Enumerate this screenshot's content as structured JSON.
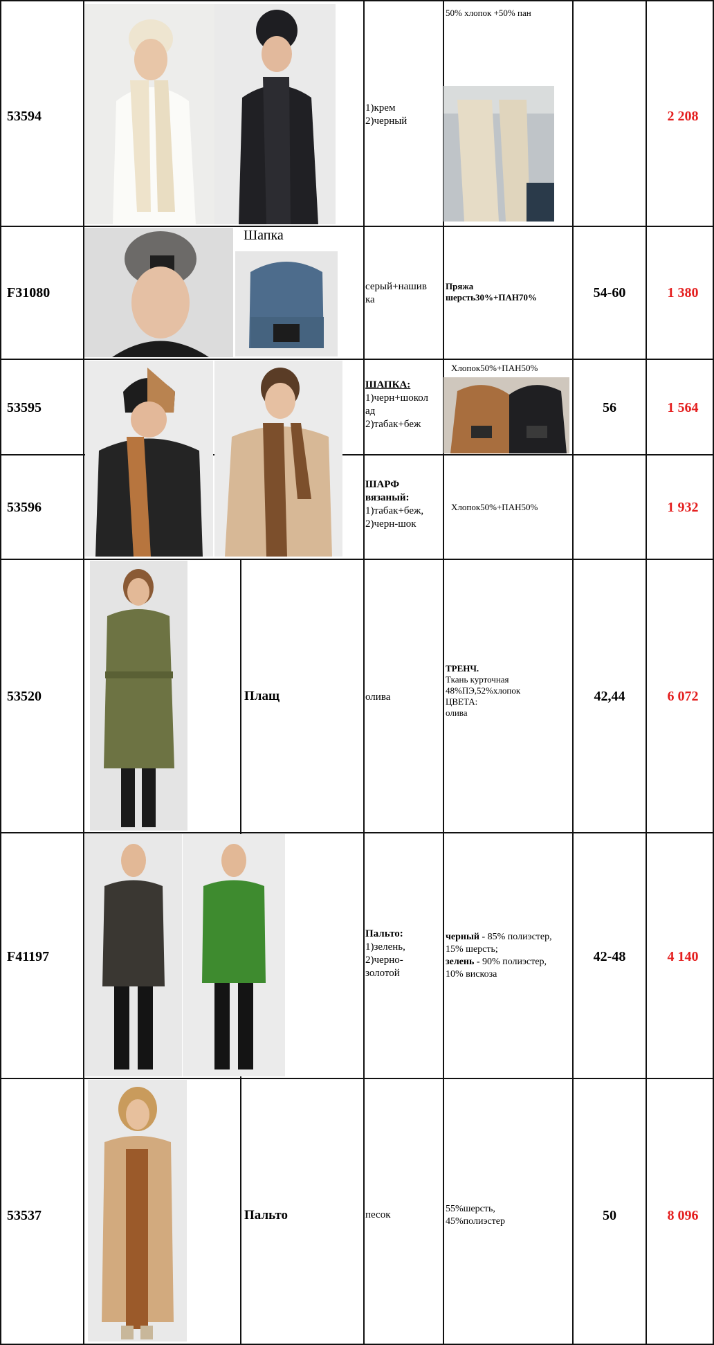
{
  "rows": [
    {
      "article": "53594",
      "name": "",
      "colors": [
        "1)крем",
        "2)черный"
      ],
      "composition_top": "50% хлопок +50% пан",
      "size": "",
      "price": "2 208"
    },
    {
      "article": "F31080",
      "name": "Шапка",
      "colors": [
        "серый+нашив",
        "ка"
      ],
      "composition": [
        "Пряжа",
        "шерсть30%+ПАН70%"
      ],
      "size": "54-60",
      "price": "1 380"
    },
    {
      "article": "53595",
      "name": "",
      "colors_head": "ШАПКА:",
      "colors": [
        "1)черн+шокол",
        "ад",
        "2)табак+беж"
      ],
      "composition_top": "Хлопок50%+ПАН50%",
      "size": "56",
      "price": "1 564"
    },
    {
      "article": "53596",
      "name": "",
      "colors_head": [
        "ШАРФ",
        "вязаный:"
      ],
      "colors": [
        "1)табак+беж,",
        "2)черн-шок"
      ],
      "composition": "Хлопок50%+ПАН50%",
      "size": "",
      "price": "1 932"
    },
    {
      "article": "53520",
      "name": "Плащ",
      "colors": [
        "олива"
      ],
      "composition_head": "ТРЕНЧ.",
      "composition": [
        "Ткань курточная",
        "48%ПЭ,52%хлопок",
        "ЦВЕТА:",
        "олива"
      ],
      "size": "42,44",
      "price": "6 072"
    },
    {
      "article": "F41197",
      "name": "",
      "colors_head": "Пальто:",
      "colors": [
        "1)зелень,",
        "2)черно-",
        "золотой"
      ],
      "composition_rich": [
        {
          "bold": "черный",
          "text": " - 85% полиэстер,"
        },
        {
          "bold": "",
          "text": "15% шерсть;"
        },
        {
          "bold": "зелень",
          "text": " - 90% полиэстер,"
        },
        {
          "bold": "",
          "text": "10% вискоза"
        }
      ],
      "size": "42-48",
      "price": "4 140"
    },
    {
      "article": "53537",
      "name": "Пальто",
      "colors": [
        "песок"
      ],
      "composition": [
        " 55%шерсть,",
        "45%полиэстер"
      ],
      "size": "50",
      "price": "8 096"
    }
  ],
  "colors": {
    "price": "#e41f1f",
    "grid": "#111111"
  }
}
